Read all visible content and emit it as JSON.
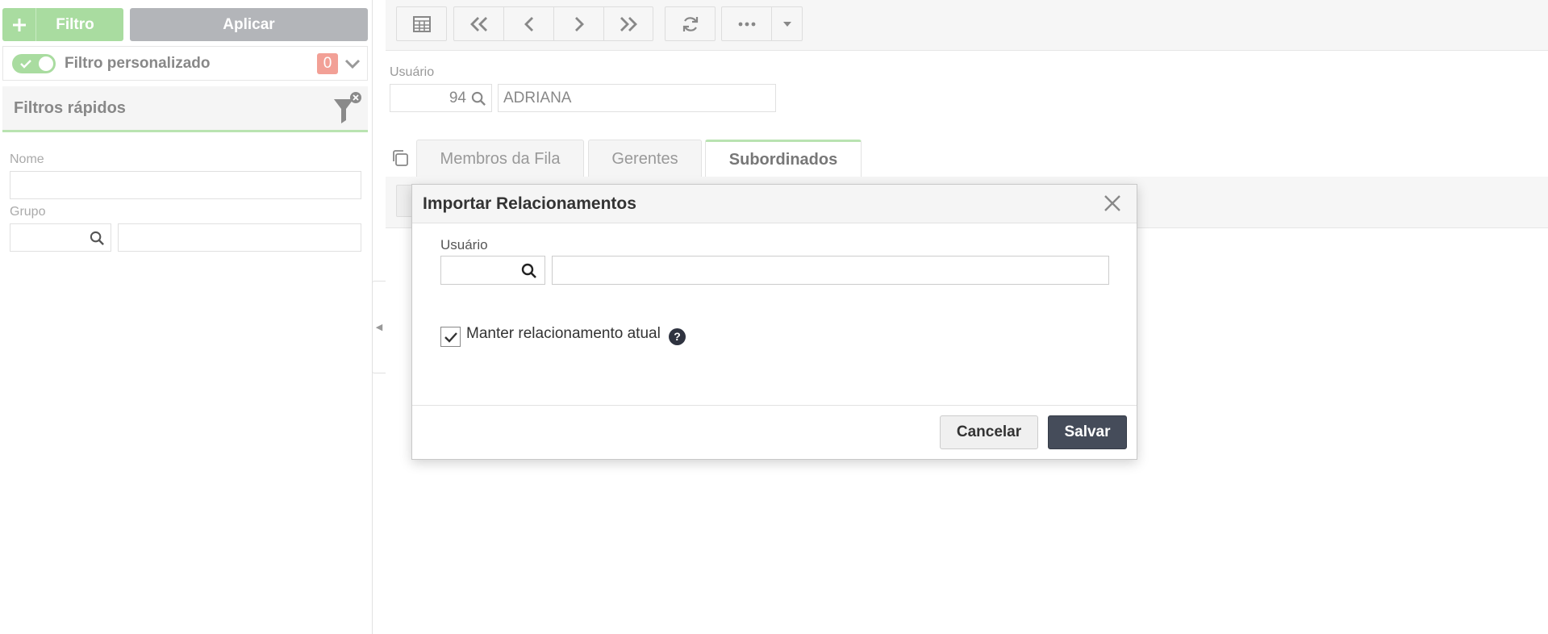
{
  "sidebar": {
    "filter_button": "Filtro",
    "apply_button": "Aplicar",
    "custom_filter": {
      "label": "Filtro personalizado",
      "count": "0"
    },
    "quick_filters": {
      "title": "Filtros rápidos",
      "fields": [
        {
          "label": "Nome",
          "value": ""
        },
        {
          "label": "Grupo",
          "code": "",
          "value": ""
        }
      ]
    }
  },
  "toolbar": {
    "icons": [
      "grid-icon",
      "first-page-icon",
      "prev-icon",
      "next-icon",
      "last-page-icon",
      "refresh-icon",
      "more-icon",
      "caret-down-icon"
    ]
  },
  "form": {
    "user_label": "Usuário",
    "user_code": "94",
    "user_name": "ADRIANA"
  },
  "tabs": [
    {
      "label": "Membros da Fila",
      "active": false
    },
    {
      "label": "Gerentes",
      "active": false
    },
    {
      "label": "Subordinados",
      "active": true
    }
  ],
  "modal": {
    "title": "Importar Relacionamentos",
    "user_label": "Usuário",
    "user_code": "",
    "user_name": "",
    "keep_label": "Manter relacionamento atual",
    "keep_checked": true,
    "help": "?",
    "cancel_label": "Cancelar",
    "save_label": "Salvar"
  },
  "colors": {
    "green_accent": "#a9dca0",
    "badge": "#f2a096",
    "save_button": "#454c5a"
  }
}
